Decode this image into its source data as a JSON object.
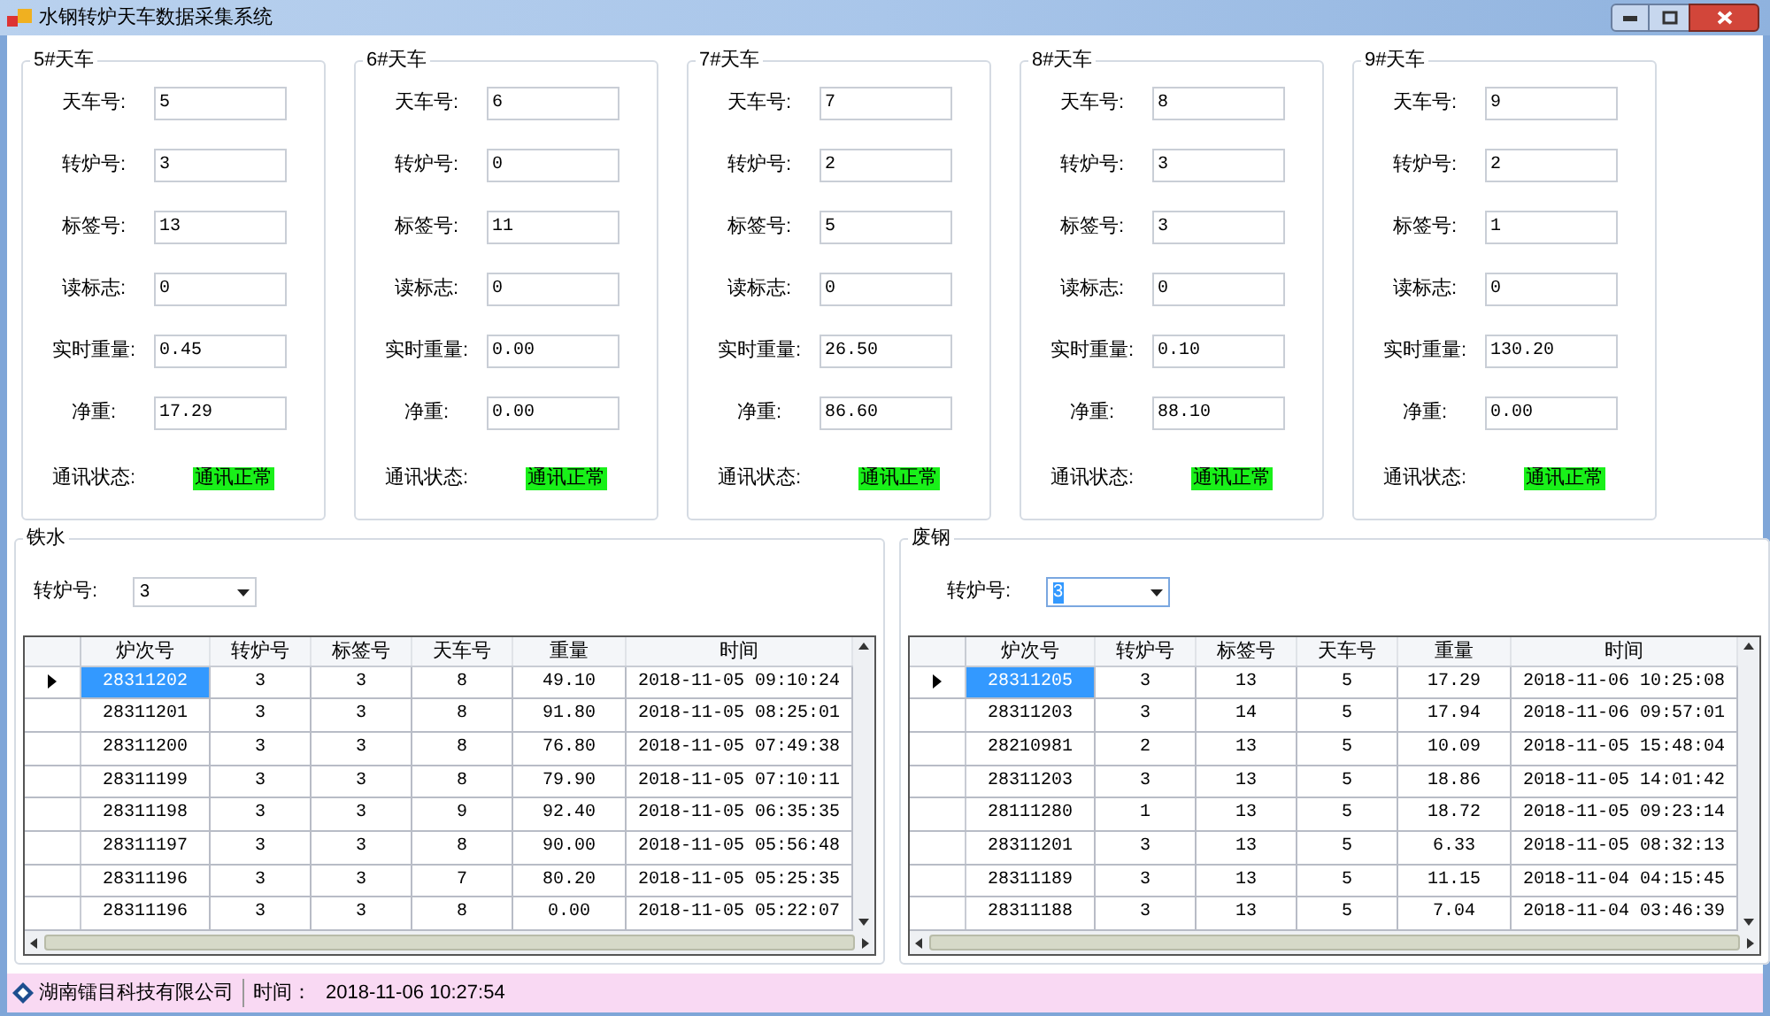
{
  "window": {
    "title": "水钢转炉天车数据采集系统"
  },
  "cranes": [
    {
      "title": "5#天车",
      "fields": [
        {
          "label": "天车号:",
          "value": "5"
        },
        {
          "label": "转炉号:",
          "value": "3"
        },
        {
          "label": "标签号:",
          "value": "13"
        },
        {
          "label": "读标志:",
          "value": "0"
        },
        {
          "label": "实时重量:",
          "value": "0.45"
        },
        {
          "label": "净重:",
          "value": "17.29"
        }
      ],
      "status_label": "通讯状态:",
      "status": "通讯正常",
      "status_ok": true
    },
    {
      "title": "6#天车",
      "fields": [
        {
          "label": "天车号:",
          "value": "6"
        },
        {
          "label": "转炉号:",
          "value": "0"
        },
        {
          "label": "标签号:",
          "value": "11"
        },
        {
          "label": "读标志:",
          "value": "0"
        },
        {
          "label": "实时重量:",
          "value": "0.00"
        },
        {
          "label": "净重:",
          "value": "0.00"
        }
      ],
      "status_label": "通讯状态:",
      "status": "通讯正常",
      "status_ok": true
    },
    {
      "title": "7#天车",
      "fields": [
        {
          "label": "天车号:",
          "value": "7"
        },
        {
          "label": "转炉号:",
          "value": "2"
        },
        {
          "label": "标签号:",
          "value": "5"
        },
        {
          "label": "读标志:",
          "value": "0"
        },
        {
          "label": "实时重量:",
          "value": "26.50"
        },
        {
          "label": "净重:",
          "value": "86.60"
        }
      ],
      "status_label": "通讯状态:",
      "status": "通讯正常",
      "status_ok": true
    },
    {
      "title": "8#天车",
      "fields": [
        {
          "label": "天车号:",
          "value": "8"
        },
        {
          "label": "转炉号:",
          "value": "3"
        },
        {
          "label": "标签号:",
          "value": "3"
        },
        {
          "label": "读标志:",
          "value": "0"
        },
        {
          "label": "实时重量:",
          "value": "0.10"
        },
        {
          "label": "净重:",
          "value": "88.10"
        }
      ],
      "status_label": "通讯状态:",
      "status": "通讯正常",
      "status_ok": true
    },
    {
      "title": "9#天车",
      "fields": [
        {
          "label": "天车号:",
          "value": "9"
        },
        {
          "label": "转炉号:",
          "value": "2"
        },
        {
          "label": "标签号:",
          "value": "1"
        },
        {
          "label": "读标志:",
          "value": "0"
        },
        {
          "label": "实时重量:",
          "value": "130.20"
        },
        {
          "label": "净重:",
          "value": "0.00"
        }
      ],
      "status_label": "通讯状态:",
      "status": "通讯正常",
      "status_ok": true
    }
  ],
  "sections": [
    {
      "title": "铁水",
      "filter_label": "转炉号:",
      "filter_value": "3",
      "filter_focused": false,
      "columns": [
        "炉次号",
        "转炉号",
        "标签号",
        "天车号",
        "重量",
        "时间"
      ],
      "rows": [
        {
          "selected": true,
          "cells": [
            "28311202",
            "3",
            "3",
            "8",
            "49.10",
            "2018-11-05 09:10:24"
          ]
        },
        {
          "selected": false,
          "cells": [
            "28311201",
            "3",
            "3",
            "8",
            "91.80",
            "2018-11-05 08:25:01"
          ]
        },
        {
          "selected": false,
          "cells": [
            "28311200",
            "3",
            "3",
            "8",
            "76.80",
            "2018-11-05 07:49:38"
          ]
        },
        {
          "selected": false,
          "cells": [
            "28311199",
            "3",
            "3",
            "8",
            "79.90",
            "2018-11-05 07:10:11"
          ]
        },
        {
          "selected": false,
          "cells": [
            "28311198",
            "3",
            "3",
            "9",
            "92.40",
            "2018-11-05 06:35:35"
          ]
        },
        {
          "selected": false,
          "cells": [
            "28311197",
            "3",
            "3",
            "8",
            "90.00",
            "2018-11-05 05:56:48"
          ]
        },
        {
          "selected": false,
          "cells": [
            "28311196",
            "3",
            "3",
            "7",
            "80.20",
            "2018-11-05 05:25:35"
          ]
        },
        {
          "selected": false,
          "cells": [
            "28311196",
            "3",
            "3",
            "8",
            "0.00",
            "2018-11-05 05:22:07"
          ]
        }
      ]
    },
    {
      "title": "废钢",
      "filter_label": "转炉号:",
      "filter_value": "3",
      "filter_focused": true,
      "columns": [
        "炉次号",
        "转炉号",
        "标签号",
        "天车号",
        "重量",
        "时间"
      ],
      "rows": [
        {
          "selected": true,
          "cells": [
            "28311205",
            "3",
            "13",
            "5",
            "17.29",
            "2018-11-06 10:25:08"
          ]
        },
        {
          "selected": false,
          "cells": [
            "28311203",
            "3",
            "14",
            "5",
            "17.94",
            "2018-11-06 09:57:01"
          ]
        },
        {
          "selected": false,
          "cells": [
            "28210981",
            "2",
            "13",
            "5",
            "10.09",
            "2018-11-05 15:48:04"
          ]
        },
        {
          "selected": false,
          "cells": [
            "28311203",
            "3",
            "13",
            "5",
            "18.86",
            "2018-11-05 14:01:42"
          ]
        },
        {
          "selected": false,
          "cells": [
            "28111280",
            "1",
            "13",
            "5",
            "18.72",
            "2018-11-05 09:23:14"
          ]
        },
        {
          "selected": false,
          "cells": [
            "28311201",
            "3",
            "13",
            "5",
            "6.33",
            "2018-11-05 08:32:13"
          ]
        },
        {
          "selected": false,
          "cells": [
            "28311189",
            "3",
            "13",
            "5",
            "11.15",
            "2018-11-04 04:15:45"
          ]
        },
        {
          "selected": false,
          "cells": [
            "28311188",
            "3",
            "13",
            "5",
            "7.04",
            "2018-11-04 03:46:39"
          ]
        }
      ]
    }
  ],
  "status_bar": {
    "company": "湖南镭目科技有限公司",
    "time_label": "时间：",
    "time": "2018-11-06 10:27:54"
  }
}
